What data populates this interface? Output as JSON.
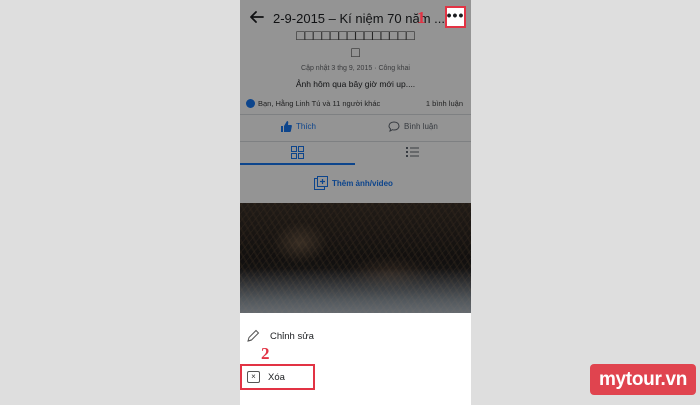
{
  "header": {
    "album_title": "2-9-2015 – Kí niệm 70 năm ...",
    "more_label": "•••"
  },
  "album": {
    "garbled_title_line1": "□□□□□□□□□□□□□□",
    "garbled_title_line2": "□",
    "meta": "Cập nhật 3 thg 9, 2015 · Công khai",
    "caption": "Ảnh hôm qua bây giờ mới up...."
  },
  "engagement": {
    "reactions_text": "Bạn, Hằng Linh Tú và 11 người khác",
    "comments_count": "1 bình luận",
    "like_label": "Thích",
    "comment_label": "Bình luận"
  },
  "add_photo_label": "Thêm ảnh/video",
  "action_sheet": {
    "edit_label": "Chỉnh sửa",
    "delete_label": "Xóa"
  },
  "annotations": {
    "step1": "1",
    "step2": "2"
  },
  "watermark": "mytour.vn",
  "colors": {
    "accent": "#1877f2",
    "highlight": "#e23344",
    "brand": "#e0444f"
  },
  "icons": [
    "back-arrow-icon",
    "more-icon",
    "like-icon",
    "comment-icon",
    "grid-icon",
    "list-icon",
    "add-photo-icon",
    "pencil-icon",
    "close-icon"
  ]
}
